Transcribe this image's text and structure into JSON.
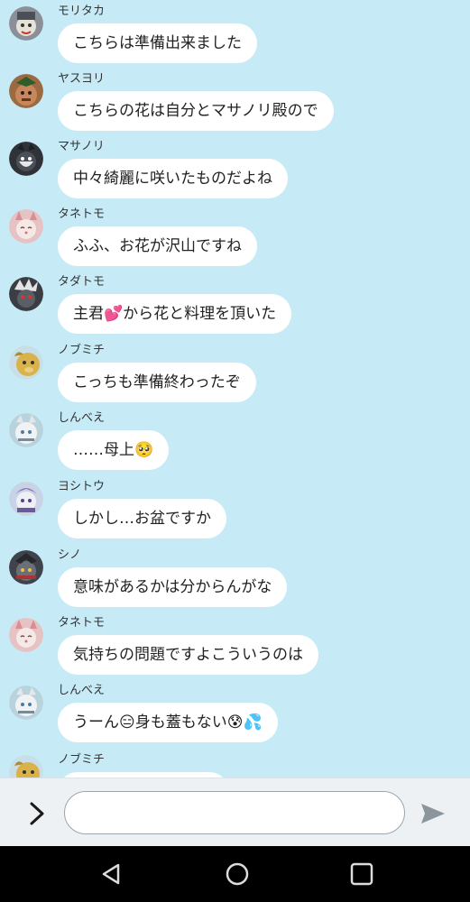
{
  "chat": {
    "messages": [
      {
        "sender": "モリタカ",
        "text": "こちらは準備出来ました",
        "emoji": "",
        "avatar_color": "#6b6f78"
      },
      {
        "sender": "ヤスヨリ",
        "text": "こちらの花は自分とマサノリ殿ので",
        "emoji": "",
        "avatar_color": "#8a5a3a"
      },
      {
        "sender": "マサノリ",
        "text": "中々綺麗に咲いたものだよね",
        "emoji": "",
        "avatar_color": "#2f3338"
      },
      {
        "sender": "タネトモ",
        "text": "ふふ、お花が沢山ですね",
        "emoji": "",
        "avatar_color": "#e9b7b5"
      },
      {
        "sender": "タダトモ",
        "text": "主君💕から花と料理を頂いた",
        "emoji": "",
        "avatar_color": "#3a3d44"
      },
      {
        "sender": "ノブミチ",
        "text": "こっちも準備終わったぞ",
        "emoji": "",
        "avatar_color": "#d9b24a"
      },
      {
        "sender": "しんべえ",
        "text": "……母上🥺",
        "emoji": "",
        "avatar_color": "#dfe3e8"
      },
      {
        "sender": "ヨシトウ",
        "text": "しかし…お盆ですか",
        "emoji": "",
        "avatar_color": "#7b6aa8"
      },
      {
        "sender": "シノ",
        "text": "意味があるかは分からんがな",
        "emoji": "",
        "avatar_color": "#4a4e57"
      },
      {
        "sender": "タネトモ",
        "text": "気持ちの問題ですよこういうのは",
        "emoji": "",
        "avatar_color": "#e9b7b5"
      },
      {
        "sender": "しんべえ",
        "text": "うーん😑身も蓋もない😰💦",
        "emoji": "",
        "avatar_color": "#dfe3e8"
      },
      {
        "sender": "ノブミチ",
        "text": "",
        "emoji": "",
        "avatar_color": "#d9b24a"
      }
    ]
  },
  "input_bar": {
    "expand_icon": "chevron-right-icon",
    "input_value": "",
    "input_placeholder": "",
    "send_icon": "send-icon"
  },
  "navbar": {
    "back_icon": "triangle-back-icon",
    "home_icon": "circle-home-icon",
    "recents_icon": "square-recents-icon"
  },
  "colors": {
    "chat_background": "#c6ebf7",
    "bubble": "#ffffff",
    "input_bar": "#eef1f4",
    "navbar": "#000000"
  }
}
